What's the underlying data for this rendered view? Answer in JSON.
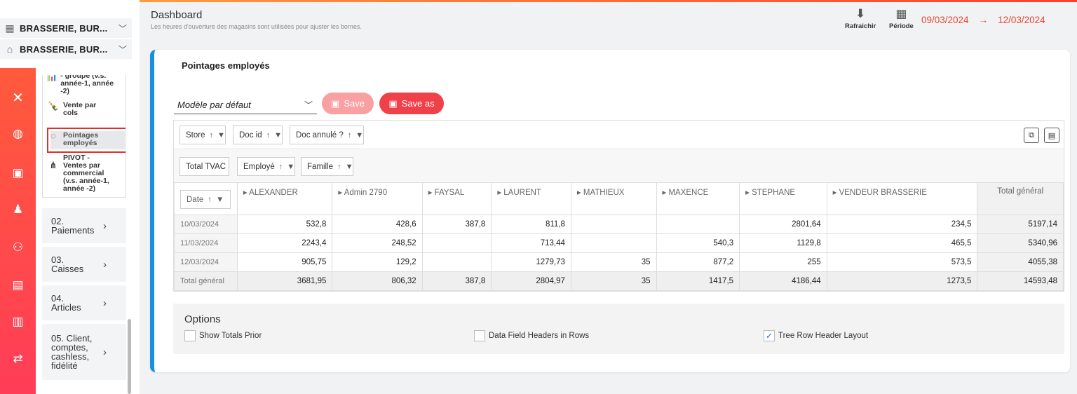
{
  "stores": [
    {
      "icon": "building-icon",
      "label": "BRASSERIE, BUR..."
    },
    {
      "icon": "shop-icon",
      "label": "BRASSERIE, BUR..."
    }
  ],
  "rail_icons": [
    "close-icon",
    "dashboard-icon",
    "bag-icon",
    "user-icon",
    "staff-icon",
    "receipt-icon",
    "clipboard-icon",
    "transfer-icon"
  ],
  "submenu": {
    "items": [
      {
        "icon": "chart-group-icon",
        "label": "- groupe (v.s. année-1, année -2)"
      },
      {
        "icon": "bottle-icon",
        "label": "Vente par cols"
      },
      {
        "icon": "clock-icon",
        "label": "Pointages employés"
      },
      {
        "icon": "hierarchy-icon",
        "label": "PIVOT - Ventes par commercial (v.s. année-1, année -2)"
      }
    ],
    "sections": [
      {
        "label": "02. Paiements"
      },
      {
        "label": "03. Caisses"
      },
      {
        "label": "04. Articles"
      },
      {
        "label": "05. Client, comptes, cashless, fidélité"
      }
    ]
  },
  "header": {
    "title": "Dashboard",
    "subtitle": "Les heures d'ouverture des magasins sont utilisées pour ajuster les bornes.",
    "refresh_label": "Rafraichir",
    "period_label": "Période",
    "date_from": "09/03/2024",
    "date_to": "12/03/2024",
    "arrow": "→"
  },
  "card": {
    "title": "Pointages employés",
    "model_select": "Modèle par défaut",
    "save_label": "Save",
    "save_as_label": "Save as"
  },
  "pivot": {
    "filter_fields": [
      "Store",
      "Doc id",
      "Doc annulé ?"
    ],
    "data_fields": [
      "Total TVAC"
    ],
    "column_fields": [
      "Employé",
      "Famille"
    ],
    "row_field": "Date",
    "columns": [
      "ALEXANDER",
      "Admin 2790",
      "FAYSAL",
      "LAURENT",
      "MATHIEUX",
      "MAXENCE",
      "STEPHANE",
      "VENDEUR BRASSERIE"
    ],
    "grand_total_label": "Total général",
    "rows": [
      {
        "date": "10/03/2024",
        "values": [
          "532,8",
          "428,6",
          "387,8",
          "811,8",
          "",
          "",
          "2801,64",
          "234,5"
        ],
        "total": "5197,14"
      },
      {
        "date": "11/03/2024",
        "values": [
          "2243,4",
          "248,52",
          "",
          "713,44",
          "",
          "540,3",
          "1129,8",
          "465,5"
        ],
        "total": "5340,96"
      },
      {
        "date": "12/03/2024",
        "values": [
          "905,75",
          "129,2",
          "",
          "1279,73",
          "35",
          "877,2",
          "255",
          "573,5"
        ],
        "total": "4055,38"
      }
    ],
    "totals": {
      "label": "Total général",
      "values": [
        "3681,95",
        "806,32",
        "387,8",
        "2804,97",
        "35",
        "1417,5",
        "4186,44",
        "1273,5"
      ],
      "total": "14593,48"
    }
  },
  "options": {
    "title": "Options",
    "items": [
      {
        "label": "Show Totals Prior",
        "checked": false
      },
      {
        "label": "Data Field Headers in Rows",
        "checked": false
      },
      {
        "label": "Tree Row Header Layout",
        "checked": true
      }
    ]
  },
  "colors": {
    "accent": "#f0404a",
    "date": "#e8452f",
    "card_border": "#1a8fe0",
    "highlight": "#e0302a"
  }
}
